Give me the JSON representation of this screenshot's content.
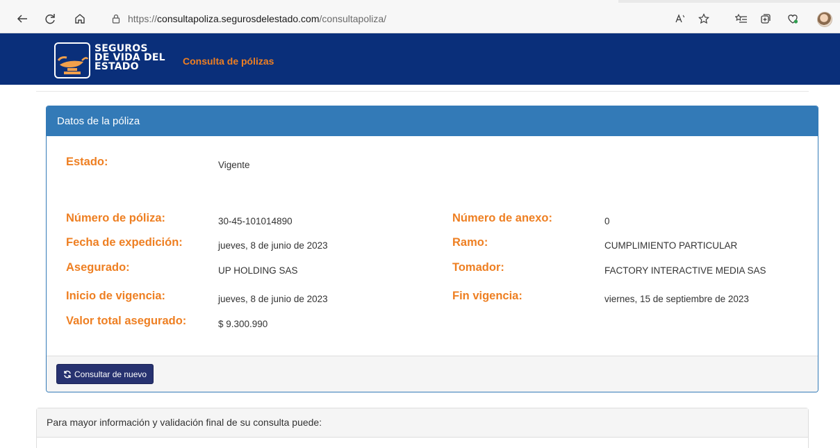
{
  "browser": {
    "url_protocol": "https://",
    "url_host": "consultapoliza.segurosdelestado.com",
    "url_path": "/consultapoliza/"
  },
  "site": {
    "logo_lines": [
      "SEGUROS",
      "DE VIDA DEL",
      "ESTADO"
    ],
    "nav_title": "Consulta de pólizas"
  },
  "policy": {
    "heading": "Datos de la póliza",
    "estado_label": "Estado:",
    "estado_value": "Vigente",
    "left": [
      {
        "label": "Número de póliza:",
        "value": "30-45-101014890"
      },
      {
        "label": "Fecha de expedición:",
        "value": "jueves, 8 de junio de 2023"
      },
      {
        "label": "Asegurado:",
        "value": "UP HOLDING SAS"
      },
      {
        "label": "Inicio de vigencia:",
        "value": "jueves, 8 de junio de 2023"
      },
      {
        "label": "Valor total asegurado:",
        "value": "$ 9.300.990"
      }
    ],
    "right": [
      {
        "label": "Número de anexo:",
        "value": "0"
      },
      {
        "label": "Ramo:",
        "value": "CUMPLIMIENTO PARTICULAR"
      },
      {
        "label": "Tomador:",
        "value": "FACTORY INTERACTIVE MEDIA SAS"
      },
      {
        "label": "Fin vigencia:",
        "value": "viernes, 15 de septiembre de 2023"
      }
    ],
    "button_label": "Consultar de nuevo"
  },
  "info": {
    "heading": "Para mayor información y validación final de su consulta puede:"
  },
  "colors": {
    "header_bg": "#0a2f7a",
    "accent_orange": "#ee7f22",
    "panel_blue": "#337ab7",
    "button_navy": "#273270"
  }
}
